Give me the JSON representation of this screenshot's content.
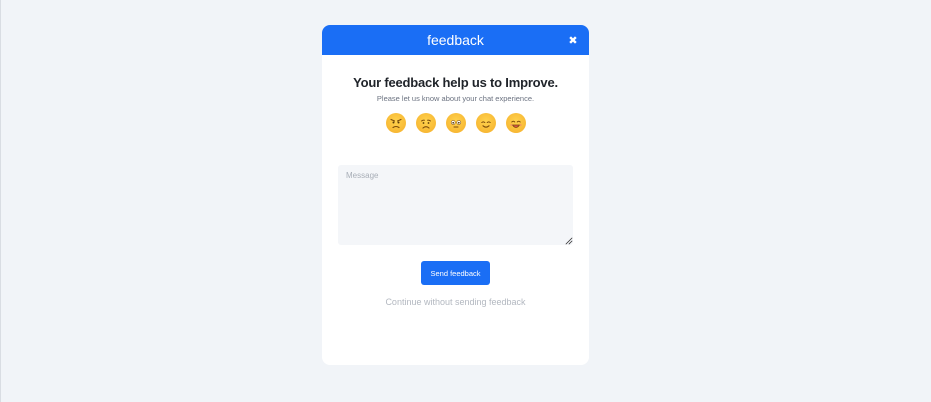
{
  "modal": {
    "title": "feedback",
    "close_icon": "close-icon",
    "heading": "Your feedback help us to Improve.",
    "subheading": "Please let us know about your chat experience.",
    "ratings": [
      {
        "name": "angry-emoji-icon"
      },
      {
        "name": "sad-emoji-icon"
      },
      {
        "name": "neutral-emoji-icon"
      },
      {
        "name": "happy-emoji-icon"
      },
      {
        "name": "very-happy-emoji-icon"
      }
    ],
    "message_placeholder": "Message",
    "send_label": "Send feedback",
    "skip_label": "Continue without sending feedback"
  },
  "colors": {
    "accent": "#1a6ef5",
    "background": "#f1f4f8",
    "emoji": "#f7b733"
  }
}
